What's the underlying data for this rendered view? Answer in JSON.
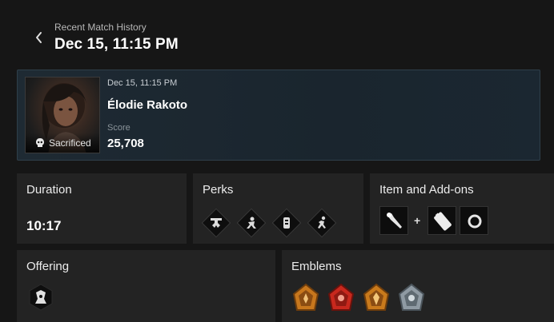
{
  "header": {
    "subtitle": "Recent Match History",
    "title": "Dec 15, 11:15 PM"
  },
  "player": {
    "date": "Dec 15, 11:15 PM",
    "name": "Élodie Rakoto",
    "status": "Sacrificed",
    "score_label": "Score",
    "score": "25,708"
  },
  "duration": {
    "label": "Duration",
    "value": "10:17"
  },
  "perks": {
    "label": "Perks",
    "icons": [
      "perk-1-icon",
      "perk-2-icon",
      "perk-3-icon",
      "perk-4-icon"
    ]
  },
  "items": {
    "label": "Item and Add-ons",
    "plus": "+",
    "icons": [
      "flashlight-icon",
      "battery-addon-icon",
      "ring-addon-icon"
    ]
  },
  "offering": {
    "label": "Offering",
    "icon": "offering-icon"
  },
  "emblems": {
    "label": "Emblems",
    "icons": [
      "emblem-1-icon",
      "emblem-2-icon",
      "emblem-3-icon",
      "emblem-4-icon"
    ],
    "colors": [
      "#c7771d",
      "#c8281d",
      "#c97a1c",
      "#8f9aa3"
    ]
  },
  "colors": {
    "background": "#161616",
    "panel": "#232323",
    "card": "#1e2a33"
  }
}
